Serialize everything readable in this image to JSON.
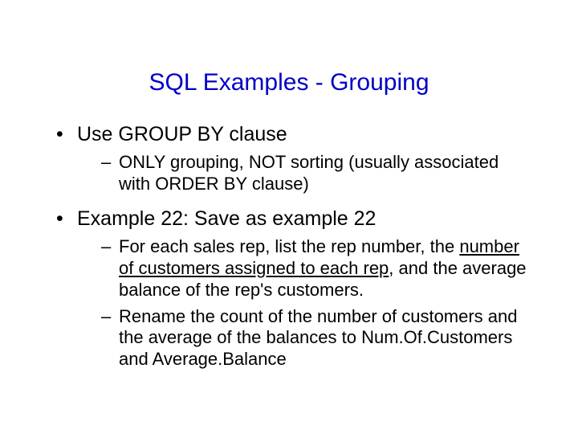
{
  "title": "SQL Examples - Grouping",
  "bullets": [
    {
      "text": "Use GROUP BY clause",
      "sub": [
        {
          "pre": "ONLY grouping, NOT sorting (usually associated with ORDER BY clause)"
        }
      ]
    },
    {
      "text": "Example 22: Save as example 22",
      "sub": [
        {
          "pre": "For each sales rep, list the rep number, the ",
          "u": "number of customers assigned to each rep",
          "post": ", and the average balance of the rep's customers."
        },
        {
          "pre": "Rename the count of the number of customers and the average of the balances to Num.Of.Customers and Average.Balance"
        }
      ]
    }
  ]
}
